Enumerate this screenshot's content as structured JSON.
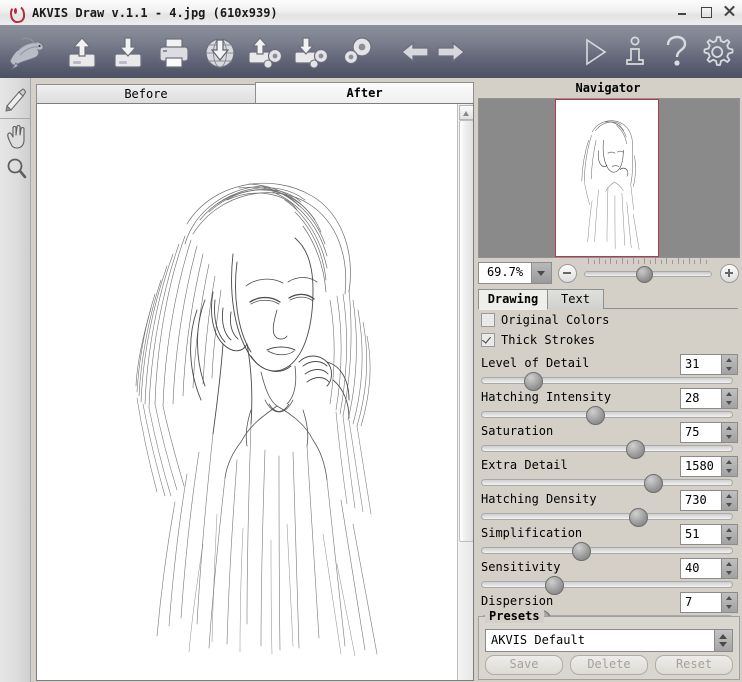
{
  "window": {
    "title": "AKVIS Draw v.1.1 - 4.jpg (610x939)",
    "app_icon": "flame-icon",
    "controls": {
      "minimize": "minimize-button",
      "maximize": "maximize-button",
      "close": "close-button"
    }
  },
  "toolbar": {
    "items": [
      {
        "name": "akvis-bird-logo",
        "label": "AKVIS"
      },
      {
        "name": "open-image-icon",
        "label": "Open Image"
      },
      {
        "name": "save-image-icon",
        "label": "Save Image"
      },
      {
        "name": "print-image-icon",
        "label": "Print Image"
      },
      {
        "name": "publish-web-icon",
        "label": "Publish"
      },
      {
        "name": "import-settings-icon",
        "label": "Import Settings"
      },
      {
        "name": "export-settings-icon",
        "label": "Export Settings"
      },
      {
        "name": "preferences-gears-icon",
        "label": "Preferences"
      },
      {
        "name": "undo-arrow-icon",
        "label": "Undo"
      },
      {
        "name": "redo-arrow-icon",
        "label": "Redo"
      },
      {
        "name": "run-play-icon",
        "label": "Run"
      },
      {
        "name": "about-info-icon",
        "label": "About"
      },
      {
        "name": "help-question-icon",
        "label": "Help"
      },
      {
        "name": "settings-gear-icon",
        "label": "Settings"
      }
    ]
  },
  "tools": [
    {
      "name": "history-brush-tool",
      "label": "History Brush"
    },
    {
      "name": "hand-tool",
      "label": "Hand"
    },
    {
      "name": "zoom-tool",
      "label": "Zoom"
    }
  ],
  "canvas": {
    "tabs": [
      {
        "label": "Before",
        "active": false
      },
      {
        "label": "After",
        "active": true
      }
    ],
    "scrollbar": "vertical-scrollbar"
  },
  "navigator": {
    "title": "Navigator",
    "zoom_value": "69.7%",
    "zoom_minus": "−",
    "zoom_plus": "+",
    "viewport_color": "#b03a52"
  },
  "settings": {
    "tabs": [
      {
        "label": "Drawing",
        "active": true
      },
      {
        "label": "Text",
        "active": false
      }
    ],
    "checkboxes": [
      {
        "label": "Original Colors",
        "checked": false
      },
      {
        "label": "Thick Strokes",
        "checked": true
      }
    ],
    "params": [
      {
        "label": "Level of Detail",
        "value": "31",
        "fill": 0.17
      },
      {
        "label": "Hatching Intensity",
        "value": "28",
        "fill": 0.42
      },
      {
        "label": "Saturation",
        "value": "75",
        "fill": 0.58
      },
      {
        "label": "Extra Detail",
        "value": "1580",
        "fill": 0.65
      },
      {
        "label": "Hatching Density",
        "value": "730",
        "fill": 0.59
      },
      {
        "label": "Simplification",
        "value": "51",
        "fill": 0.36
      },
      {
        "label": "Sensitivity",
        "value": "40",
        "fill": 0.26
      },
      {
        "label": "Dispersion",
        "value": "7",
        "fill": 0.21
      }
    ]
  },
  "presets": {
    "title": "Presets",
    "selected": "AKVIS Default",
    "buttons": [
      {
        "label": "Save",
        "enabled": false
      },
      {
        "label": "Delete",
        "enabled": false
      },
      {
        "label": "Reset",
        "enabled": false
      }
    ]
  }
}
